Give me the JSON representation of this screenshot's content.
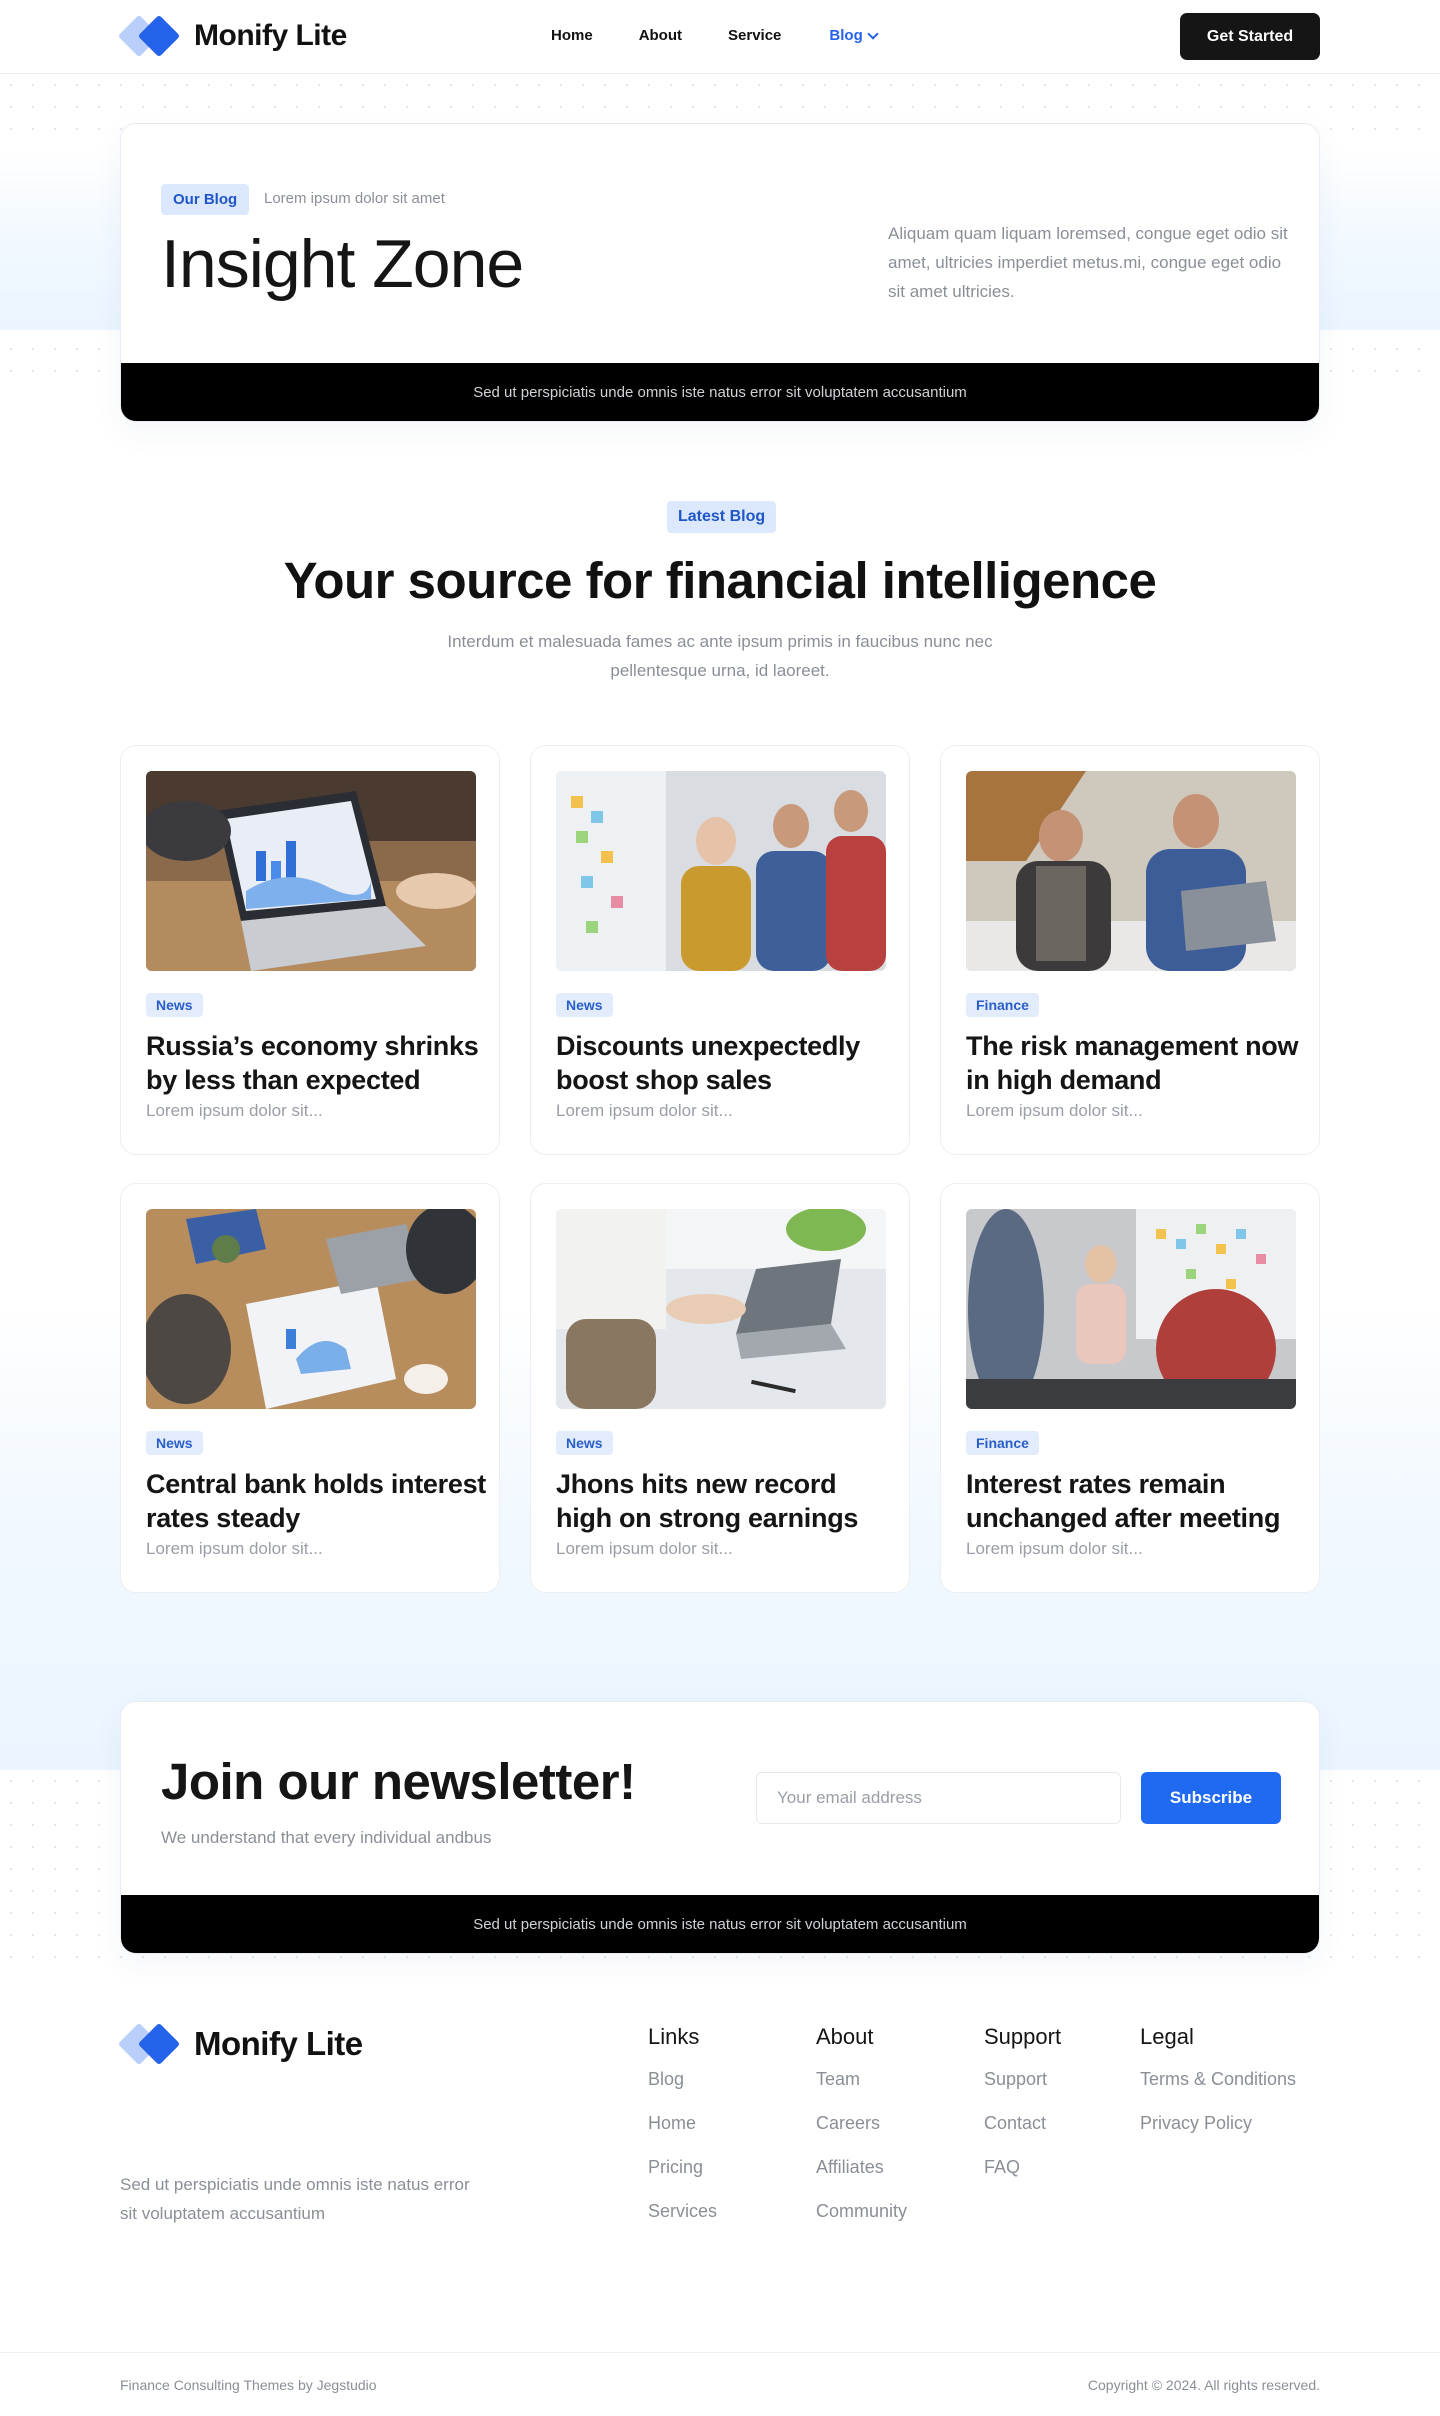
{
  "nav": {
    "brand": "Monify Lite",
    "items": [
      {
        "label": "Home"
      },
      {
        "label": "About"
      },
      {
        "label": "Service"
      },
      {
        "label": "Blog"
      }
    ],
    "cta": "Get Started"
  },
  "hero": {
    "tag": "Our Blog",
    "subtag": "Lorem ipsum dolor sit amet",
    "title": "Insight Zone",
    "description": "Aliquam quam liquam loremsed, congue eget odio sit amet, ultricies imperdiet metus.mi, congue eget odio sit amet ultricies.",
    "bar_text": "Sed ut perspiciatis unde omnis iste natus error sit voluptatem accusantium"
  },
  "latest": {
    "tag": "Latest Blog",
    "title": "Your source for financial intelligence",
    "description": "Interdum et malesuada fames ac ante ipsum primis in faucibus nunc nec pellentesque urna, id laoreet."
  },
  "posts": [
    {
      "category": "News",
      "title": "Russia’s economy shrinks by less than expected",
      "excerpt": "Lorem ipsum dolor sit..."
    },
    {
      "category": "News",
      "title": "Discounts unexpectedly boost shop sales",
      "excerpt": "Lorem ipsum dolor sit..."
    },
    {
      "category": "Finance",
      "title": "The risk management now in high demand",
      "excerpt": "Lorem ipsum dolor sit..."
    },
    {
      "category": "News",
      "title": "Central bank holds interest rates steady",
      "excerpt": "Lorem ipsum dolor sit..."
    },
    {
      "category": "News",
      "title": "Jhons hits new record high on strong earnings",
      "excerpt": "Lorem ipsum dolor sit..."
    },
    {
      "category": "Finance",
      "title": "Interest rates remain unchanged after meeting",
      "excerpt": "Lorem ipsum dolor sit..."
    }
  ],
  "newsletter": {
    "title": "Join our newsletter!",
    "subtitle": "We understand that every individual andbus",
    "placeholder": "Your email address",
    "button": "Subscribe",
    "bar_text": "Sed ut perspiciatis unde omnis iste natus error sit voluptatem accusantium"
  },
  "footer": {
    "brand": "Monify Lite",
    "description": "Sed ut perspiciatis unde omnis iste natus error sit voluptatem accusantium",
    "columns": [
      {
        "heading": "Links",
        "items": [
          "Blog",
          "Home",
          "Pricing",
          "Services"
        ]
      },
      {
        "heading": "About",
        "items": [
          "Team",
          "Careers",
          "Affiliates",
          "Community"
        ]
      },
      {
        "heading": "Support",
        "items": [
          "Support",
          "Contact",
          "FAQ"
        ]
      },
      {
        "heading": "Legal",
        "items": [
          "Terms & Conditions",
          "Privacy Policy"
        ]
      }
    ],
    "credit": "Finance Consulting Themes by Jegstudio",
    "copyright": "Copyright © 2024. All rights reserved."
  },
  "colors": {
    "accent": "#2563eb",
    "dark": "#151515",
    "tag_bg": "#dbe8fd",
    "muted": "#8a8f97"
  }
}
